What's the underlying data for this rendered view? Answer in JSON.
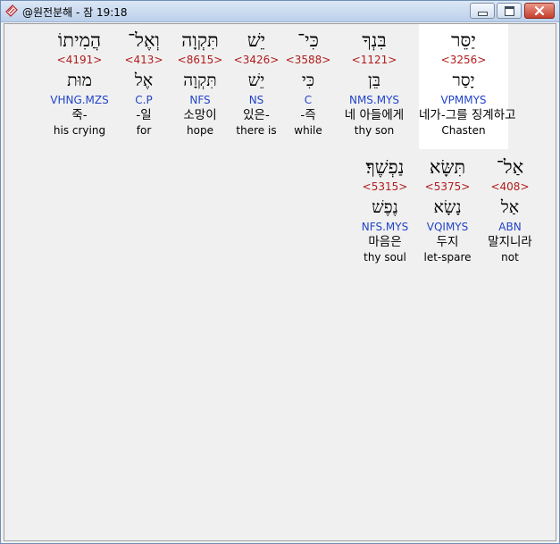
{
  "window": {
    "title": "@원전분해 - 잠 19:18",
    "icon": "app-book-icon",
    "controls": [
      "minimize-icon",
      "maximize-icon",
      "close-icon"
    ],
    "colors": {
      "strong": "#b11c1c",
      "parse": "#2244c8",
      "selected_bg": "#ffffff"
    }
  },
  "words": [
    {
      "hebrew": "יַסֵּר",
      "strong": "<3256>",
      "root": "יָסַר",
      "parse": "VPMMYS",
      "korean": "네가-그를 징계하고",
      "english": "Chasten"
    },
    {
      "hebrew": "בִּנְךָ",
      "strong": "<1121>",
      "root": "בֵּן",
      "parse": "NMS.MYS",
      "korean": "네 아들에게",
      "english": "thy son"
    },
    {
      "hebrew": "כִּי־",
      "strong": "<3588>",
      "root": "כִּי",
      "parse": "C",
      "korean": "-즉",
      "english": "while"
    },
    {
      "hebrew": "יֵשׁ",
      "strong": "<3426>",
      "root": "יֵשׁ",
      "parse": "NS",
      "korean": "있은-",
      "english": "there is"
    },
    {
      "hebrew": "תִּקְוָה",
      "strong": "<8615>",
      "root": "תִּקְוָה",
      "parse": "NFS",
      "korean": "소망이",
      "english": "hope"
    },
    {
      "hebrew": "וְאֶל־",
      "strong": "<413>",
      "root": "אֶל",
      "parse": "C.P",
      "korean": "-일",
      "english": "for"
    },
    {
      "hebrew": "הֲמִיתוֹ",
      "strong": "<4191>",
      "root": "מוּת",
      "parse": "VHNG.MZS",
      "korean": "죽-",
      "english": "his crying"
    },
    {
      "hebrew": "אַל־",
      "strong": "<408>",
      "root": "אַל",
      "parse": "ABN",
      "korean": "말지니라",
      "english": "not"
    },
    {
      "hebrew": "תִּשָּׂא",
      "strong": "<5375>",
      "root": "נָשָׂא",
      "parse": "VQIMYS",
      "korean": "두지",
      "english": "let-spare"
    },
    {
      "hebrew": "נַפְשֶׁךָ׃",
      "strong": "<5315>",
      "root": "נֶפֶשׁ",
      "parse": "NFS.MYS",
      "korean": "마음은",
      "english": "thy soul"
    }
  ]
}
